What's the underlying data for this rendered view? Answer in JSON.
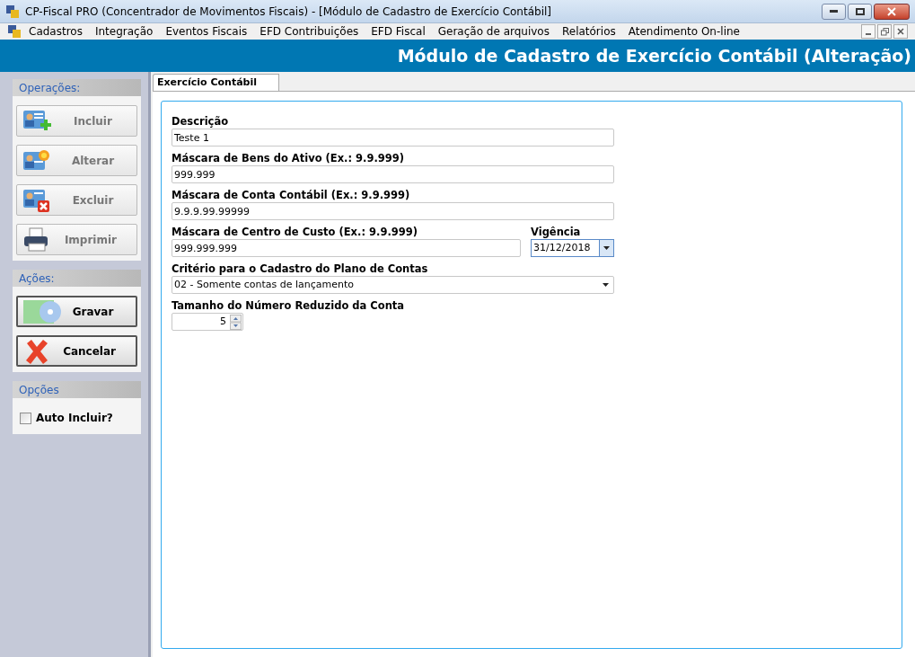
{
  "window": {
    "title": "CP-Fiscal PRO (Concentrador de Movimentos Fiscais) - [Módulo de Cadastro de Exercício Contábil]"
  },
  "menu": [
    "Cadastros",
    "Integração",
    "Eventos Fiscais",
    "EFD Contribuições",
    "EFD Fiscal",
    "Geração de arquivos",
    "Relatórios",
    "Atendimento On-line"
  ],
  "header": "Módulo de Cadastro de Exercício Contábil (Alteração)",
  "sidebar": [
    {
      "title": "Operações:",
      "buttons": [
        {
          "label": "Incluir",
          "kind": "add",
          "disabled": true
        },
        {
          "label": "Alterar",
          "kind": "edit",
          "disabled": true
        },
        {
          "label": "Excluir",
          "kind": "delete",
          "disabled": true
        },
        {
          "label": "Imprimir",
          "kind": "print",
          "disabled": true
        }
      ]
    },
    {
      "title": "Ações:",
      "buttons": [
        {
          "label": "Gravar",
          "kind": "save",
          "disabled": false
        },
        {
          "label": "Cancelar",
          "kind": "cancel",
          "disabled": false
        }
      ]
    },
    {
      "title": "Opções",
      "checkboxes": [
        {
          "label": "Auto Incluir?",
          "checked": false
        }
      ]
    }
  ],
  "tabs": [
    {
      "label": "Exercício Contábil",
      "selected": true
    }
  ],
  "form": {
    "descricao": {
      "label": "Descrição",
      "value": "Teste 1"
    },
    "bens": {
      "label": "Máscara de Bens do Ativo (Ex.: 9.9.999)",
      "value": "999.999"
    },
    "conta": {
      "label": "Máscara de Conta Contábil (Ex.: 9.9.999)",
      "value": "9.9.9.99.99999"
    },
    "centro": {
      "label": "Máscara de Centro de Custo (Ex.: 9.9.999)",
      "value": "999.999.999"
    },
    "vigencia": {
      "label": "Vigência",
      "value": "31/12/2018"
    },
    "criterio": {
      "label": "Critério para o Cadastro do Plano de Contas",
      "value": "02 - Somente contas de lançamento"
    },
    "tamanho": {
      "label": "Tamanho do Número Reduzido da Conta",
      "value": "5"
    }
  }
}
